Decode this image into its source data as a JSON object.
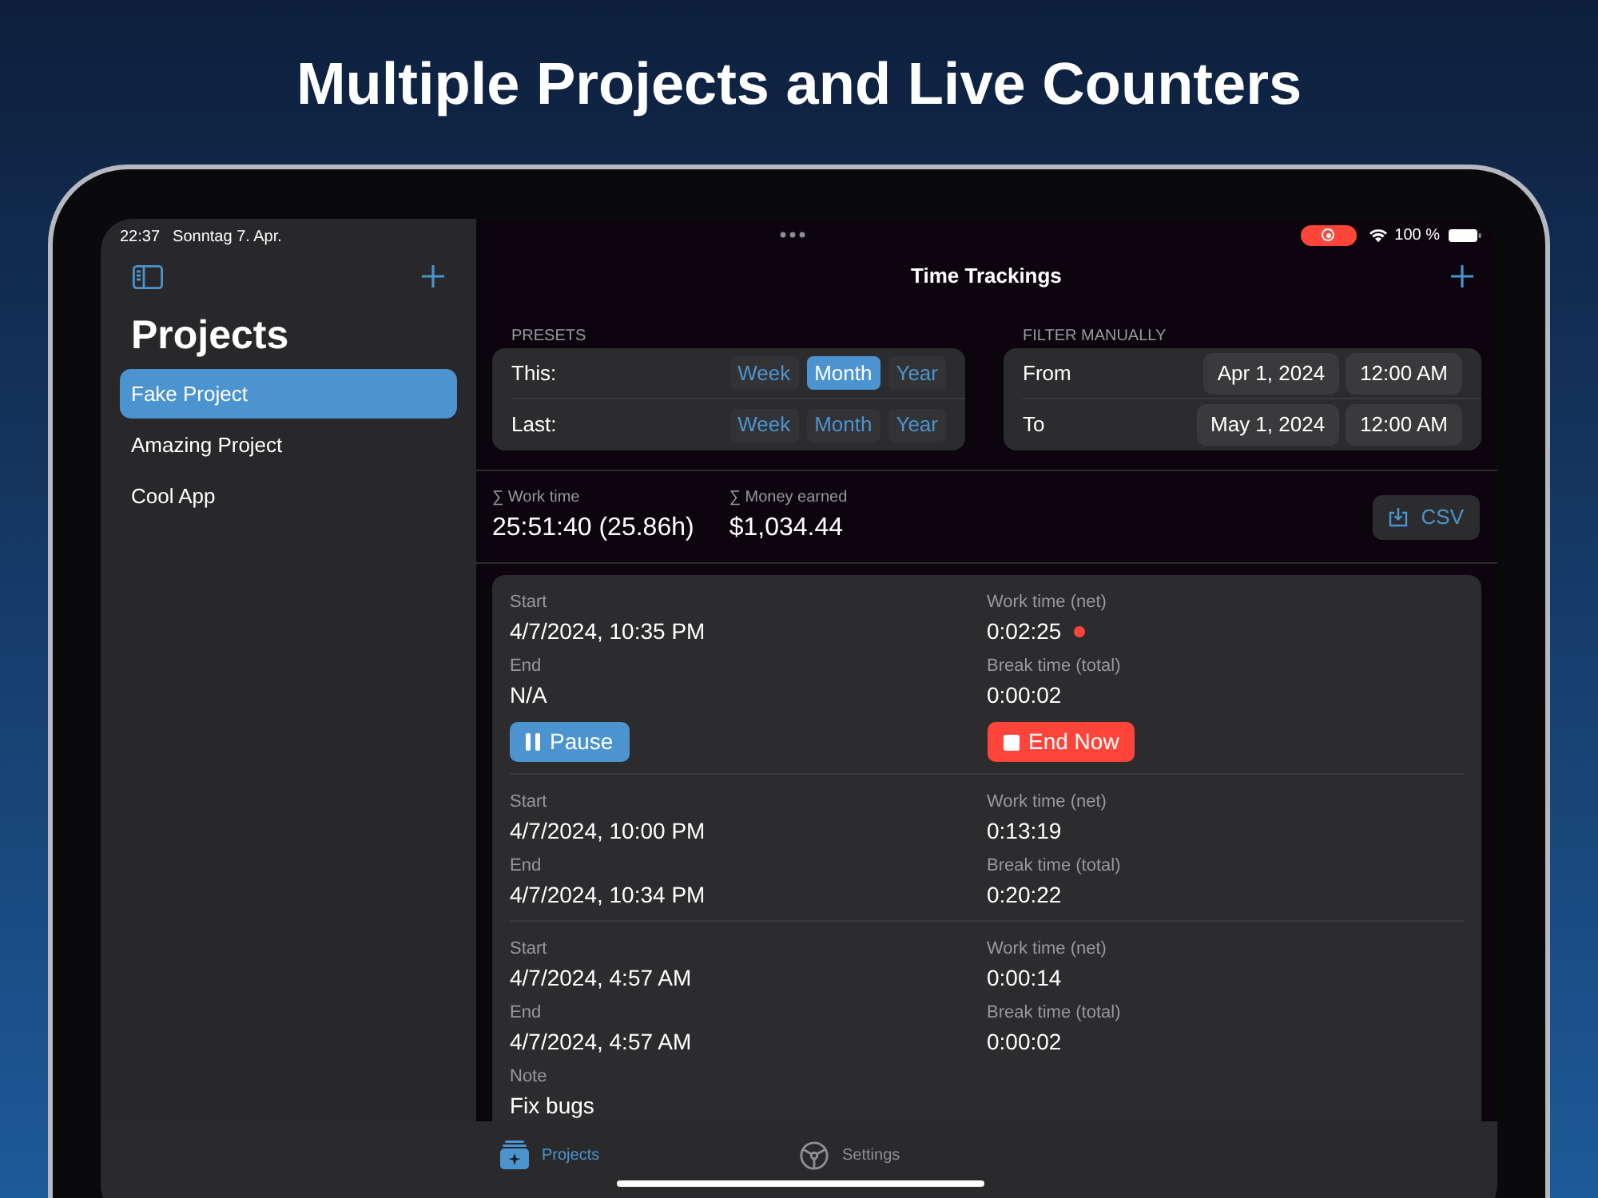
{
  "headline": "Multiple Projects and Live Counters",
  "status_bar": {
    "time": "22:37",
    "date": "Sonntag 7. Apr.",
    "battery": "100 %",
    "recording": true
  },
  "sidebar": {
    "title": "Projects",
    "items": [
      {
        "label": "Fake Project",
        "selected": true
      },
      {
        "label": "Amazing Project",
        "selected": false
      },
      {
        "label": "Cool App",
        "selected": false
      }
    ]
  },
  "nav_title": "Time Trackings",
  "presets": {
    "heading": "PRESETS",
    "rows": [
      {
        "label": "This:",
        "options": [
          {
            "label": "Week",
            "selected": false
          },
          {
            "label": "Month",
            "selected": true
          },
          {
            "label": "Year",
            "selected": false
          }
        ]
      },
      {
        "label": "Last:",
        "options": [
          {
            "label": "Week",
            "selected": false
          },
          {
            "label": "Month",
            "selected": false
          },
          {
            "label": "Year",
            "selected": false
          }
        ]
      }
    ]
  },
  "filter": {
    "heading": "FILTER MANUALLY",
    "rows": [
      {
        "label": "From",
        "date": "Apr 1, 2024",
        "time": "12:00 AM"
      },
      {
        "label": "To",
        "date": "May 1, 2024",
        "time": "12:00 AM"
      }
    ]
  },
  "summary": [
    {
      "label": "∑ Work time",
      "value": "25:51:40 (25.86h)"
    },
    {
      "label": "∑ Money earned",
      "value": "$1,034.44"
    }
  ],
  "export_button": "CSV",
  "entries": [
    {
      "running": true,
      "left": [
        {
          "label": "Start",
          "value": "4/7/2024, 10:35 PM"
        },
        {
          "label": "End",
          "value": "N/A"
        }
      ],
      "right": [
        {
          "label": "Work time (net)",
          "value": "0:02:25"
        },
        {
          "label": "Break time (total)",
          "value": "0:00:02"
        }
      ],
      "actions": [
        {
          "kind": "pause",
          "label": "Pause"
        },
        {
          "kind": "stop",
          "label": "End Now"
        }
      ]
    },
    {
      "running": false,
      "left": [
        {
          "label": "Start",
          "value": "4/7/2024, 10:00 PM"
        },
        {
          "label": "End",
          "value": "4/7/2024, 10:34 PM"
        }
      ],
      "right": [
        {
          "label": "Work time (net)",
          "value": "0:13:19"
        },
        {
          "label": "Break time (total)",
          "value": "0:20:22"
        }
      ]
    },
    {
      "running": false,
      "left": [
        {
          "label": "Start",
          "value": "4/7/2024, 4:57 AM"
        },
        {
          "label": "End",
          "value": "4/7/2024, 4:57 AM"
        },
        {
          "label": "Note",
          "value": "Fix bugs"
        }
      ],
      "right": [
        {
          "label": "Work time (net)",
          "value": "0:00:14"
        },
        {
          "label": "Break time (total)",
          "value": "0:00:02"
        }
      ]
    }
  ],
  "tab_bar": [
    {
      "kind": "projects",
      "label": "Projects",
      "selected": true
    },
    {
      "kind": "settings",
      "label": "Settings",
      "selected": false
    }
  ]
}
